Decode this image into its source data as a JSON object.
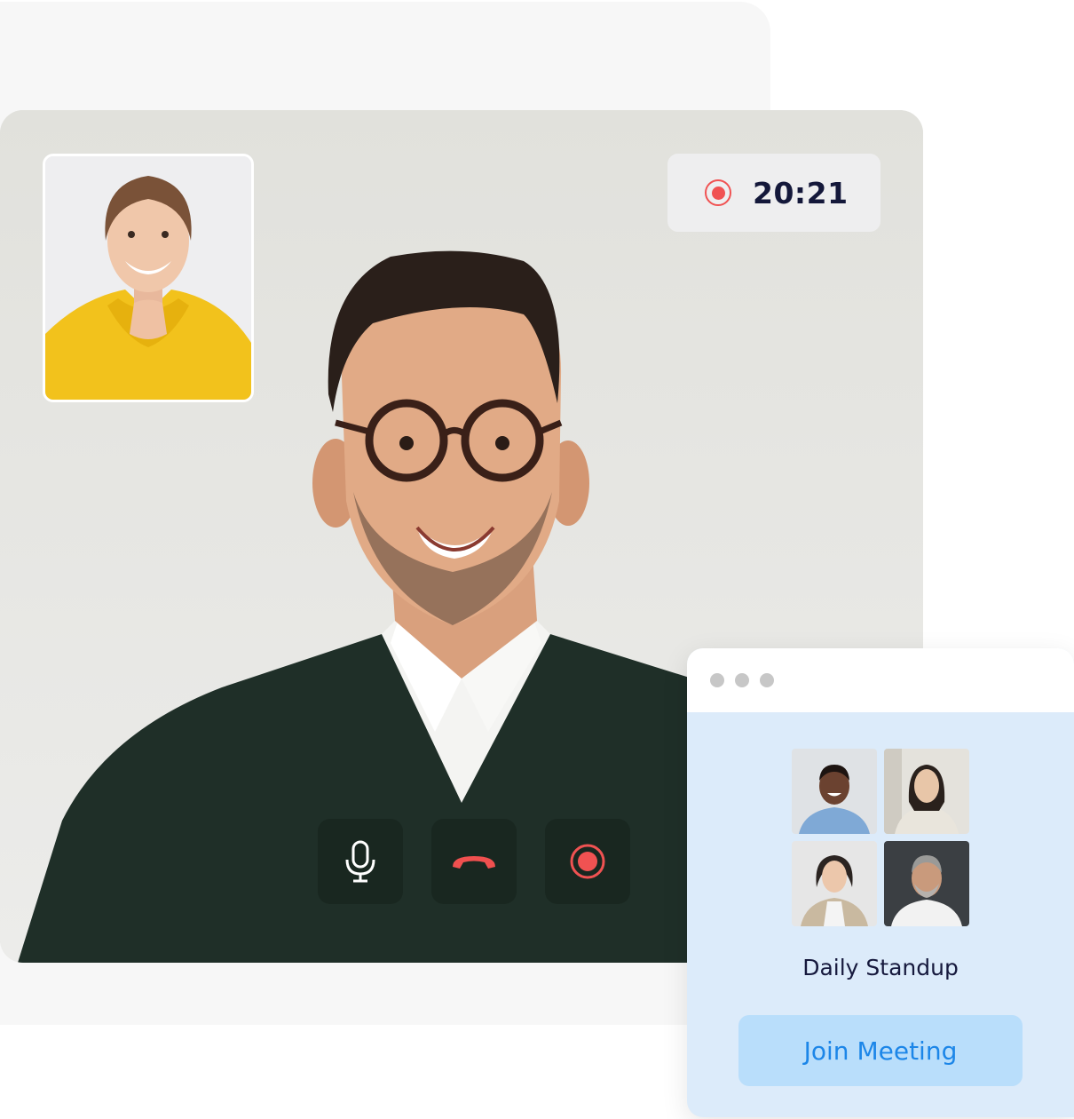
{
  "call": {
    "timer": "20:21",
    "recording": true,
    "controls": {
      "mic_icon": "microphone-icon",
      "hangup_icon": "hang-up-phone-icon",
      "record_icon": "record-icon"
    }
  },
  "meeting": {
    "window_dots": 3,
    "participants": [
      {
        "icon": "participant-avatar"
      },
      {
        "icon": "participant-avatar"
      },
      {
        "icon": "participant-avatar"
      },
      {
        "icon": "participant-avatar"
      }
    ],
    "title": "Daily Standup",
    "join_label": "Join Meeting"
  },
  "colors": {
    "record_red": "#f05252",
    "hangup_red": "#f0504f",
    "join_text": "#1c86e8",
    "join_bg": "#b9defb",
    "card_bg": "#dcebfa",
    "timer_text": "#14183a"
  }
}
